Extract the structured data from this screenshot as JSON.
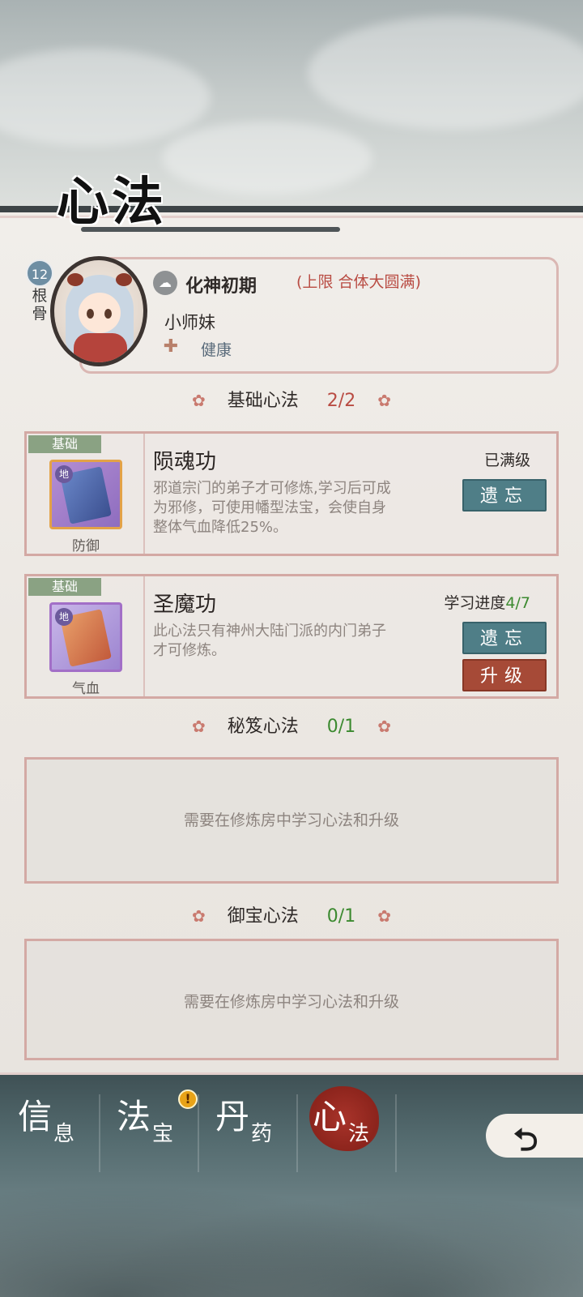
{
  "page_title": "心法",
  "character": {
    "level": "12",
    "level_label": "根骨",
    "realm": "化神初期",
    "realm_limit": "(上限 合体大圆满)",
    "name": "小师妹",
    "health": "健康"
  },
  "sections": {
    "basic": {
      "label": "基础心法",
      "count": "2/2"
    },
    "secret": {
      "label": "秘笈心法",
      "count": "0/1"
    },
    "treasure": {
      "label": "御宝心法",
      "count": "0/1"
    }
  },
  "skills": [
    {
      "tag": "基础",
      "type": "防御",
      "name": "陨魂功",
      "desc": "邪道宗门的弟子才可修炼,学习后可成为邪修，可使用幡型法宝，会使自身整体气血降低25%。",
      "status": "已满级",
      "forget_label": "遗忘"
    },
    {
      "tag": "基础",
      "type": "气血",
      "name": "圣魔功",
      "desc": "此心法只有神州大陆门派的内门弟子才可修炼。",
      "status_label": "学习进度",
      "status_progress": "4/7",
      "progress_fraction": 0.571,
      "forget_label": "遗忘",
      "upgrade_label": "升级"
    }
  ],
  "empty_slot_text": "需要在修炼房中学习心法和升级",
  "nav": {
    "tabs": [
      {
        "big": "信",
        "small": "息"
      },
      {
        "big": "法",
        "small": "宝"
      },
      {
        "big": "丹",
        "small": "药"
      },
      {
        "big": "心",
        "small": "法"
      }
    ],
    "alert": "!",
    "back_icon": "back-arrow-icon"
  },
  "colors": {
    "forget_button": "#4f7e87",
    "upgrade_button": "#a64a37",
    "progress_green": "#3c8a30",
    "limit_red": "#b94c43",
    "tag_green": "#8aa283"
  }
}
